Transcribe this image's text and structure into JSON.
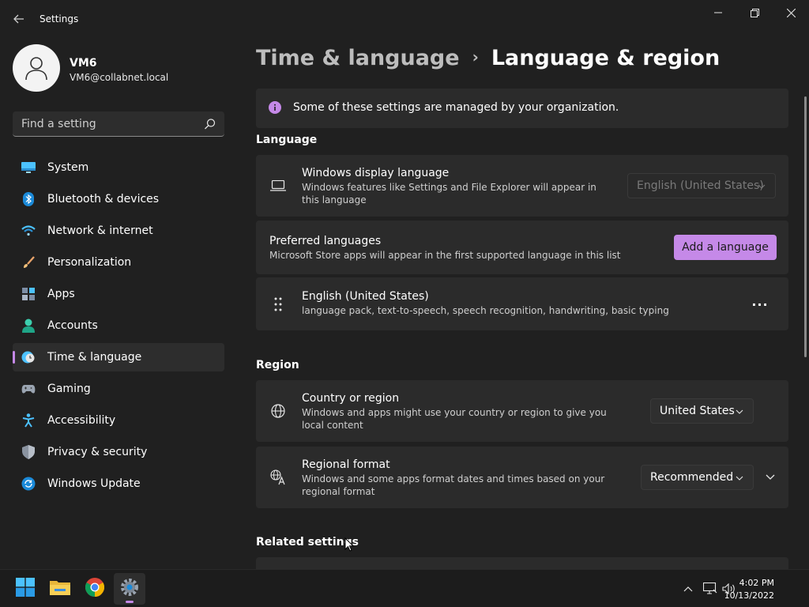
{
  "window": {
    "app_title": "Settings",
    "minimize_glyph": "—",
    "restore_glyph": "❐",
    "close_glyph": "✕"
  },
  "profile": {
    "name": "VM6",
    "email": "VM6@collabnet.local"
  },
  "search": {
    "placeholder": "Find a setting"
  },
  "sidebar": {
    "items": [
      {
        "label": "System",
        "icon": "monitor-icon"
      },
      {
        "label": "Bluetooth & devices",
        "icon": "bluetooth-icon"
      },
      {
        "label": "Network & internet",
        "icon": "wifi-icon"
      },
      {
        "label": "Personalization",
        "icon": "brush-icon"
      },
      {
        "label": "Apps",
        "icon": "apps-icon"
      },
      {
        "label": "Accounts",
        "icon": "person-icon"
      },
      {
        "label": "Time & language",
        "icon": "clock-globe-icon",
        "active": true
      },
      {
        "label": "Gaming",
        "icon": "gamepad-icon"
      },
      {
        "label": "Accessibility",
        "icon": "accessibility-icon"
      },
      {
        "label": "Privacy & security",
        "icon": "shield-icon"
      },
      {
        "label": "Windows Update",
        "icon": "update-icon"
      }
    ]
  },
  "breadcrumb": {
    "parent": "Time & language",
    "current": "Language & region"
  },
  "notice": {
    "text": "Some of these settings are managed by your organization."
  },
  "language": {
    "section_title": "Language",
    "display_language": {
      "title": "Windows display language",
      "description": "Windows features like Settings and File Explorer will appear in this language",
      "value": "English (United States)"
    },
    "preferred": {
      "title": "Preferred languages",
      "description": "Microsoft Store apps will appear in the first supported language in this list",
      "button": "Add a language"
    },
    "entry": {
      "title": "English (United States)",
      "description": "language pack, text-to-speech, speech recognition, handwriting, basic typing",
      "more": "···"
    }
  },
  "region": {
    "section_title": "Region",
    "country": {
      "title": "Country or region",
      "description": "Windows and apps might use your country or region to give you local content",
      "value": "United States"
    },
    "format": {
      "title": "Regional format",
      "description": "Windows and some apps format dates and times based on your regional format",
      "value": "Recommended"
    }
  },
  "related": {
    "section_title": "Related settings"
  },
  "taskbar": {
    "time": "4:02 PM",
    "date": "10/13/2022"
  },
  "colors": {
    "accent": "#c589e8",
    "background": "#202020",
    "card": "#2b2b2b"
  }
}
